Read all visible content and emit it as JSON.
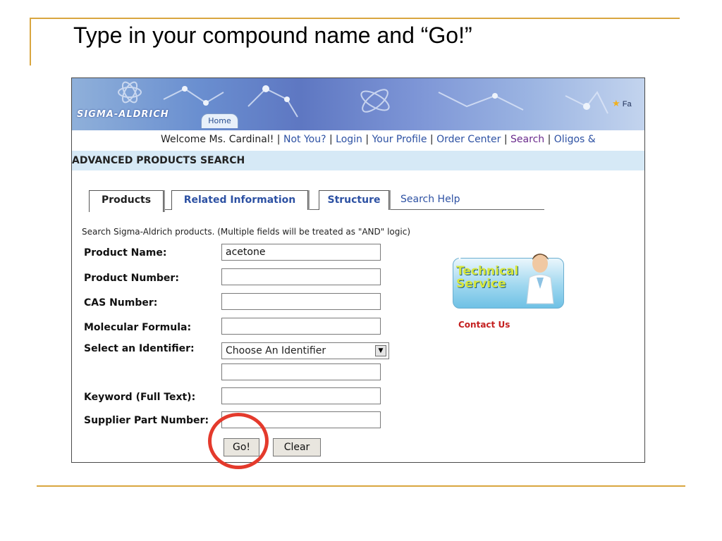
{
  "slide": {
    "title": "Type in your compound name and “Go!”"
  },
  "header": {
    "logo": "SIGMA-ALDRICH",
    "home_tab": "Home",
    "favorites_partial": "Fa",
    "welcome_text": "Welcome Ms. Cardinal! | ",
    "links": [
      "Not You?",
      "Login",
      "Your Profile",
      "Order Center",
      "Search",
      "Oligos &"
    ]
  },
  "page": {
    "section_title": "ADVANCED PRODUCTS SEARCH",
    "tabs": [
      "Products",
      "Related Information",
      "Structure"
    ],
    "help_link": "Search Help",
    "intro": "Search Sigma-Aldrich products. (Multiple fields will be treated as \"AND\" logic)"
  },
  "form": {
    "fields": [
      {
        "label": "Product Name:",
        "value": "acetone"
      },
      {
        "label": "Product Number:",
        "value": ""
      },
      {
        "label": "CAS Number:",
        "value": ""
      },
      {
        "label": "Molecular Formula:",
        "value": ""
      }
    ],
    "identifier_label": "Select an Identifier:",
    "identifier_selected": "Choose An Identifier",
    "identifier_value": "",
    "keyword_label": "Keyword (Full Text):",
    "keyword_value": "",
    "supplier_label": "Supplier Part Number:",
    "supplier_value": "",
    "go_label": "Go!",
    "clear_label": "Clear"
  },
  "promo": {
    "line1": "Technical",
    "line2": "Service",
    "contact": "Contact Us"
  },
  "colors": {
    "accent_rule": "#d9a63f",
    "link": "#2d51a3",
    "section_bg": "#d6e9f6",
    "highlight": "#e43a2c"
  }
}
